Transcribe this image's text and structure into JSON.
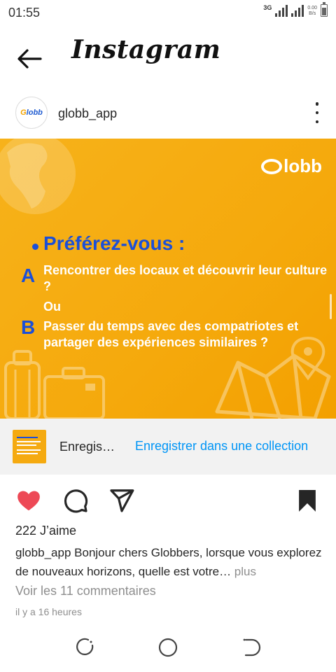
{
  "status_bar": {
    "time": "01:55",
    "network": "3G",
    "speed_value": "0.00",
    "speed_unit": "B/s"
  },
  "header": {
    "title": "Instagram"
  },
  "post": {
    "username": "globb_app",
    "avatar_logo_a": "G",
    "avatar_logo_b": "lobb",
    "image": {
      "brand": "lobb",
      "question": "Préférez-vous :",
      "option_a_letter": "A",
      "option_a_text": "Rencontrer des locaux et découvrir leur culture ?",
      "or_text": "Ou",
      "option_b_letter": "B",
      "option_b_text": "Passer du temps avec des compatriotes et partager des expériences similaires ?"
    },
    "save_bar": {
      "saved_label": "Enregis…",
      "collection_link": "Enregistrer dans une collection"
    },
    "likes": "222 J’aime",
    "caption_user": "globb_app",
    "caption_text": " Bonjour chers Globbers, lorsque vous explorez de nouveaux horizons, quelle est votre…",
    "caption_more": " plus",
    "view_comments": "Voir les 11 commentaires",
    "time_ago": "il y a 16 heures",
    "liked": true,
    "saved": true
  },
  "colors": {
    "accent_blue": "#0095f6",
    "like_red": "#ed4956",
    "post_orange": "#f5a90c",
    "post_blue": "#1b4fd8"
  },
  "icons": [
    "back-arrow-icon",
    "more-options-icon",
    "heart-icon",
    "comment-icon",
    "share-icon",
    "bookmark-icon",
    "recents-icon",
    "home-icon",
    "back-nav-icon"
  ]
}
